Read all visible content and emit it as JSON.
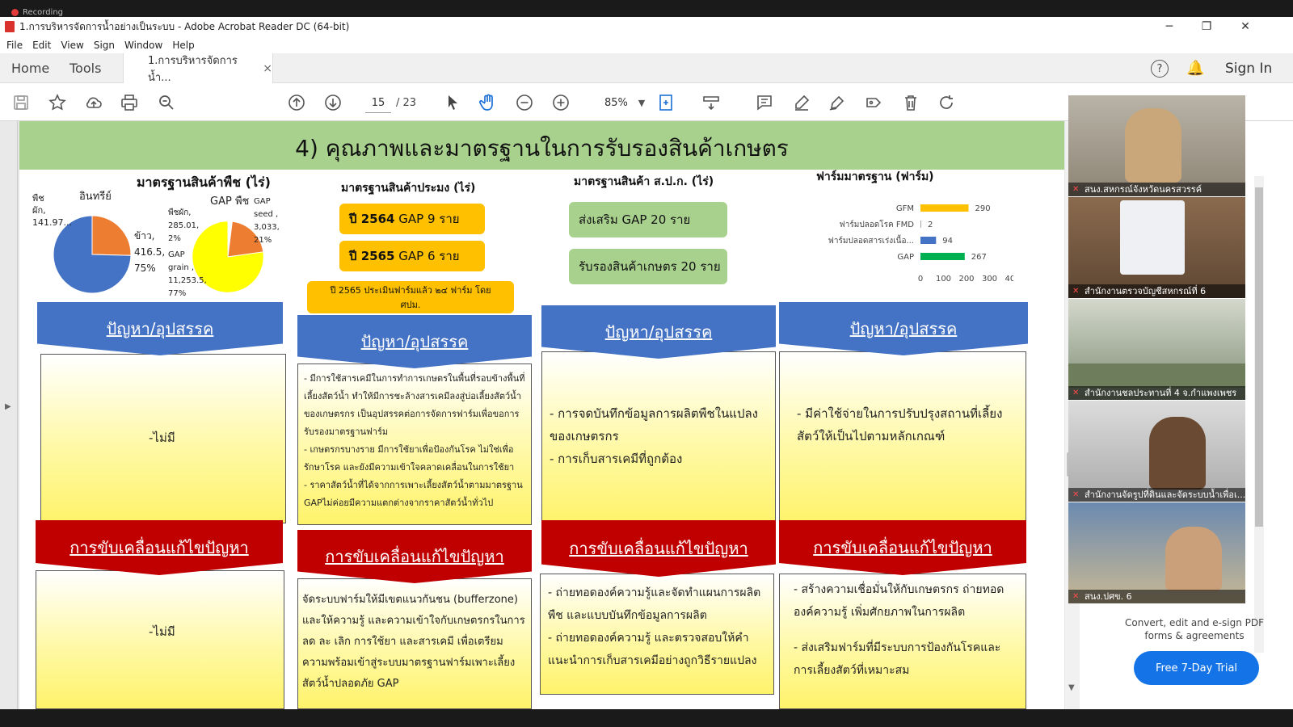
{
  "recording": {
    "label": "Recording"
  },
  "window": {
    "title": "1.การบริหารจัดการน้ำอย่างเป็นระบบ - Adobe Acrobat Reader DC (64-bit)",
    "minimize": "─",
    "maximize": "❐",
    "close": "✕"
  },
  "menu": [
    "File",
    "Edit",
    "View",
    "Sign",
    "Window",
    "Help"
  ],
  "tabs": {
    "home": "Home",
    "tools": "Tools",
    "doc": "1.การบริหารจัดการน้ำ...",
    "close": "×",
    "help": "?",
    "sign_in": "Sign In"
  },
  "toolbar": {
    "page_current": "15",
    "page_total": "/ 23",
    "zoom": "85%"
  },
  "slide": {
    "title": "4) คุณภาพและมาตรฐานในการรับรองสินค้าเกษตร",
    "chart1": {
      "title": "มาตรฐานสินค้าพืช (ไร่)",
      "pie1_left_label": "พืชผัก, 141.97...",
      "pie1_organic": "อินทรีย์",
      "pie1_rice": "ข้าว, 416.5, 75%",
      "gap_plants": "GAP พืช",
      "pie2_veg": "พืชผัก, 285.01, 2%",
      "pie2_seed": "GAP seed , 3,033, 21%",
      "pie2_grain": "GAP grain , 11,253.5, 77%"
    },
    "fishery": {
      "title": "มาตรฐานสินค้าประมง (ไร่)",
      "box1_year": "ปี 2564",
      "box1_text": "GAP 9 ราย",
      "box2_year": "ปี 2565",
      "box2_text": "GAP 6 ราย",
      "box3": "ปี 2565 ประเมินฟาร์มแล้ว ๒๔ ฟาร์ม โดย ศปม."
    },
    "alro": {
      "title": "มาตรฐานสินค้า ส.ป.ก. (ไร่)",
      "box1": "ส่งเสริม GAP 20 ราย",
      "box2": "รับรองสินค้าเกษตร 20 ราย"
    },
    "livestock": {
      "title": "ฟาร์มมาตรฐาน (ฟาร์ม)"
    },
    "problem_header": "ปัญหา/อุปสรรค",
    "solution_header": "การขับเคลื่อนแก้ไขปัญหา",
    "col1": {
      "problem": "-ไม่มี",
      "solution": "-ไม่มี"
    },
    "col2": {
      "problem": [
        "- มีการใช้สารเคมีในการทำการเกษตรในพื้นที่รอบข้างพื้นที่เลี้ยงสัตว์น้ำ ทำให้มีการชะล้างสารเคมีลงสู่บ่อเลี้ยงสัตว์น้ำของเกษตรกร เป็นอุปสรรคต่อการจัดการฟาร์มเพื่อขอการรับรองมาตรฐานฟาร์ม",
        "- เกษตรกรบางราย มีการใช้ยาเพื่อป้องกันโรค ไม่ใช่เพื่อรักษาโรค และยังมีความเข้าใจคลาดเคลื่อนในการใช้ยา",
        "- ราคาสัตว์น้ำที่ได้จากการเพาะเลี้ยงสัตว์น้ำตามมาตรฐาน GAPไม่ค่อยมีความแตกต่างจากราคาสัตว์น้ำทั่วไป"
      ],
      "solution": "จัดระบบฟาร์มให้มีเขตแนวกันชน (bufferzone) และให้ความรู้ และความเข้าใจกับเกษตรกรในการลด ละ เลิก การใช้ยา และสารเคมี เพื่อเตรียมความพร้อมเข้าสู่ระบบมาตรฐานฟาร์มเพาะเลี้ยงสัตว์น้ำปลอดภัย GAP"
    },
    "col3": {
      "problem": [
        "- การจดบันทึกข้อมูลการผลิตพืชในแปลงของเกษตรกร",
        "- การเก็บสารเคมีที่ถูกต้อง"
      ],
      "solution": [
        "- ถ่ายทอดองค์ความรู้และจัดทำแผนการผลิตพืช และแบบบันทึกข้อมูลการผลิต",
        "- ถ่ายทอดองค์ความรู้ และตรวจสอบให้คำแนะนำการเก็บสารเคมีอย่างถูกวิธีรายแปลง"
      ]
    },
    "col4": {
      "problem": "- มีค่าใช้จ่ายในการปรับปรุงสถานที่เลี้ยงสัตว์ให้เป็นไปตามหลักเกณฑ์",
      "solution": [
        "- สร้างความเชื่อมั่นให้กับเกษตรกร ถ่ายทอดองค์ความรู้ เพิ่มศักยภาพในการผลิต",
        "- ส่งเสริมฟาร์มที่มีระบบการป้องกันโรคและการเลี้ยงสัตว์ที่เหมาะสม"
      ]
    }
  },
  "chart_data": [
    {
      "type": "pie",
      "title": "มาตรฐานสินค้าพืช (ไร่)",
      "categories": [
        "พืชผัก",
        "ข้าว"
      ],
      "values": [
        141.97,
        416.5
      ],
      "colors": [
        "#ed7d31",
        "#4472c4"
      ]
    },
    {
      "type": "pie",
      "title": "GAP พืช",
      "categories": [
        "พืชผัก",
        "GAP seed",
        "GAP grain"
      ],
      "values": [
        285.01,
        3033,
        11253.5
      ],
      "colors": [
        "#ffffff",
        "#ed7d31",
        "#ffff00"
      ]
    },
    {
      "type": "bar",
      "title": "ฟาร์มมาตรฐาน (ฟาร์ม)",
      "orientation": "horizontal",
      "categories": [
        "GFM",
        "ฟาร์มปลอดโรค FMD",
        "ฟาร์มปลอดสารเร่งเนื้อ...",
        "GAP"
      ],
      "values": [
        290,
        2,
        94,
        267
      ],
      "colors": [
        "#ffc000",
        "#a5a5a5",
        "#4472c4",
        "#00b050"
      ],
      "xlim": [
        0,
        400
      ],
      "xticks": [
        "0",
        "100",
        "200",
        "300",
        "400"
      ]
    }
  ],
  "right_panel": {
    "caption": "Convert, edit and e-sign PDF forms & agreements",
    "trial_button": "Free 7-Day Trial"
  },
  "participants": [
    {
      "name": "สนง.สหกรณ์จังหวัดนครสวรรค์"
    },
    {
      "name": "สำนักงานตรวจบัญชีสหกรณ์ที่ 6"
    },
    {
      "name": "สำนักงานชลประทานที่ 4 จ.กำแพงเพชร"
    },
    {
      "name": "สำนักงานจัดรูปที่ดินและจัดระบบน้ำเพื่อเ..."
    },
    {
      "name": "สนง.ปศข. 6"
    }
  ]
}
